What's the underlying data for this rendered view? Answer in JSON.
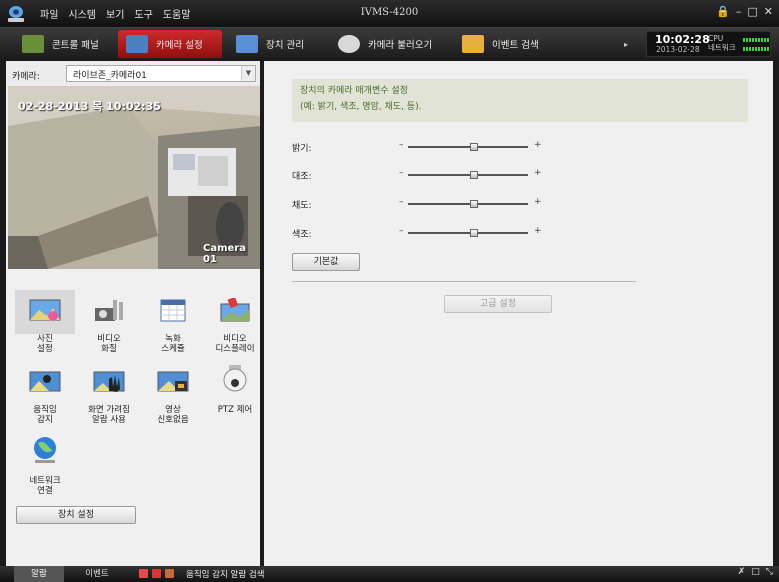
{
  "window": {
    "title": "IVMS-4200",
    "menu": [
      "파일",
      "시스템",
      "보기",
      "도구",
      "도움말"
    ],
    "controls": [
      "🔒",
      "–",
      "□",
      "✕"
    ]
  },
  "toolbar": {
    "tabs": [
      {
        "label": "콘트롤 패널",
        "icon": "control-panel-icon",
        "color": "#6a8f3a"
      },
      {
        "label": "카메라 설정",
        "icon": "camera-settings-icon",
        "color": "#4b7fc1",
        "active": true
      },
      {
        "label": "장치 관리",
        "icon": "device-management-icon",
        "color": "#5a8fd6"
      },
      {
        "label": "카메라 불러오기",
        "icon": "camera-import-icon",
        "color": "#dddddd"
      },
      {
        "label": "이벤트 검색",
        "icon": "event-search-icon",
        "color": "#e8b03a"
      }
    ],
    "clock_time": "10:02:28",
    "clock_date": "2013-02-28",
    "cpu_label": "CPU",
    "network_label": "네트워크"
  },
  "camera": {
    "label": "카메라:",
    "selected": "라이브존_카메라01",
    "osd_datetime": "02-28-2013 목 10:02:35",
    "osd_name": "Camera 01"
  },
  "settings_menu": {
    "items": [
      {
        "label": [
          "사진",
          "설정"
        ],
        "icon": "picture-settings-icon",
        "selected": true
      },
      {
        "label": [
          "비디오",
          "화질"
        ],
        "icon": "video-quality-icon"
      },
      {
        "label": [
          "녹화",
          "스케쥴"
        ],
        "icon": "record-schedule-icon"
      },
      {
        "label": [
          "비디오",
          "디스플레이"
        ],
        "icon": "video-display-icon"
      },
      {
        "label": [
          "움직임",
          "감지"
        ],
        "icon": "motion-detection-icon"
      },
      {
        "label": [
          "화면 가려짐",
          "알람 사용"
        ],
        "icon": "tamper-alarm-icon"
      },
      {
        "label": [
          "영상",
          "신호없음"
        ],
        "icon": "video-loss-icon"
      },
      {
        "label": [
          "PTZ 제어"
        ],
        "icon": "ptz-control-icon"
      },
      {
        "label": [
          "네트워크",
          "연결"
        ],
        "icon": "network-connection-icon"
      }
    ],
    "device_button": "장치 설정"
  },
  "image_settings": {
    "description": [
      "장치의 카메라 매개변수 설정",
      "(예: 밝기, 색조, 명암, 채도, 등)."
    ],
    "sliders": [
      {
        "label": "밝기:",
        "value": 0.55
      },
      {
        "label": "대조:",
        "value": 0.55
      },
      {
        "label": "채도:",
        "value": 0.55
      },
      {
        "label": "색조:",
        "value": 0.55
      }
    ],
    "minus": "–",
    "plus": "+",
    "default_button": "기본값",
    "advanced_button": "고급 설정"
  },
  "statusbar": {
    "tabs": [
      {
        "label": "알람",
        "active": true
      },
      {
        "label": "이벤트"
      }
    ],
    "message": "움직임 감지 알람 검색",
    "right_controls": [
      "✗",
      "□",
      "⤡"
    ]
  }
}
